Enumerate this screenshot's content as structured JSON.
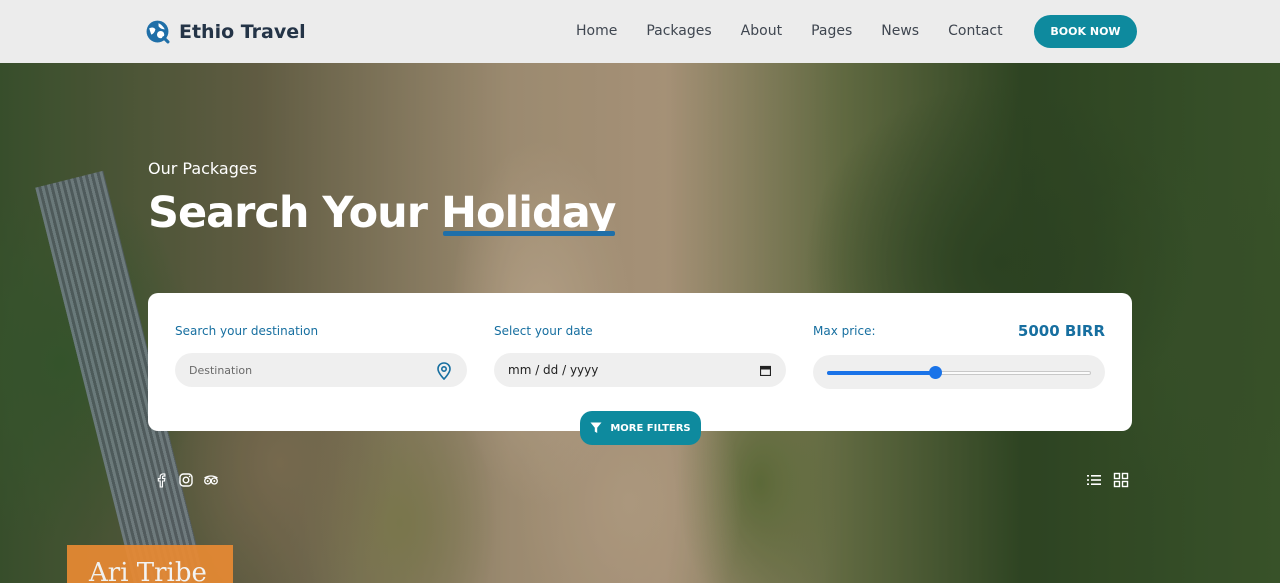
{
  "brand": {
    "name": "Ethio Travel",
    "icon": "globe-search-icon"
  },
  "nav": {
    "items": [
      {
        "label": "Home"
      },
      {
        "label": "Packages"
      },
      {
        "label": "About"
      },
      {
        "label": "Pages"
      },
      {
        "label": "News"
      },
      {
        "label": "Contact"
      }
    ],
    "cta_label": "BOOK NOW"
  },
  "hero": {
    "eyebrow": "Our Packages",
    "title_part1": "Search Your ",
    "title_highlight": "Holiday"
  },
  "search": {
    "destination_label": "Search your destination",
    "destination_placeholder": "Destination",
    "date_label": "Select your date",
    "date_value": "mm / dd / yyyy",
    "price_label": "Max price:",
    "price_value": "5000 BIRR",
    "price_slider_fraction": 0.41,
    "filters_label": "MORE FILTERS"
  },
  "social_icons": [
    "facebook-icon",
    "instagram-icon",
    "tripadvisor-icon"
  ],
  "view_icons": [
    "list-view-icon",
    "grid-view-icon"
  ],
  "featured_tag": "Ari Tribe",
  "colors": {
    "accent": "#0e8a9e",
    "label_blue": "#176fa0",
    "slider_blue": "#1a73e8",
    "navbar_bg": "#ececec",
    "tag_orange": "#e88a33"
  }
}
